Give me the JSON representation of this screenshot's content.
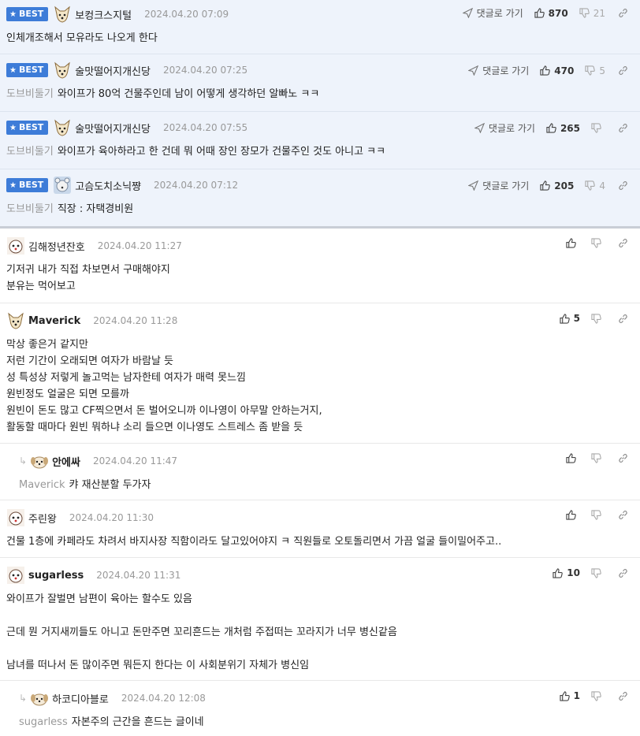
{
  "labels": {
    "best": "BEST",
    "reply_link": "댓글로 가기"
  },
  "best_comments": [
    {
      "nick": "보컹크스지털",
      "date": "2024.04.20 07:09",
      "reply_to": "",
      "text": "인체개조해서 모유라도 나오게 한다",
      "likes": "870",
      "dislikes": "21"
    },
    {
      "nick": "술맛떨어지개신당",
      "date": "2024.04.20 07:25",
      "reply_to": "도브비둘기",
      "text": "와이프가 80억 건물주인데 남이 어떻게 생각하던 알빠노 ㅋㅋ",
      "likes": "470",
      "dislikes": "5"
    },
    {
      "nick": "술맛떨어지개신당",
      "date": "2024.04.20 07:55",
      "reply_to": "도브비둘기",
      "text": "와이프가 육아하라고 한 건데 뭐 어때 장인 장모가 건물주인 것도 아니고 ㅋㅋ",
      "likes": "265",
      "dislikes": ""
    },
    {
      "nick": "고슴도치소닉쨩",
      "date": "2024.04.20 07:12",
      "reply_to": "도브비둘기",
      "text": "직장 : 자택경비원",
      "likes": "205",
      "dislikes": "4"
    }
  ],
  "comments": [
    {
      "nick": "김해정년잔호",
      "date": "2024.04.20 11:27",
      "reply_to": "",
      "text": "기저귀 내가 직접 차보면서 구매해야지\n분유는 먹어보고",
      "likes": ""
    },
    {
      "nick": "Maverick",
      "date": "2024.04.20 11:28",
      "reply_to": "",
      "text": "막상 좋은거 같지만\n저런 기간이 오래되면 여자가 바람날 듯\n성 특성상 저렇게 놀고먹는 남자한테 여자가 매력 못느낌\n원빈정도 얼굴은 되면 모를까\n원빈이 돈도 많고 CF찍으면서 돈 벌어오니까 이나영이 아무말 안하는거지,\n활동할 때마다 원빈 뭐하냐 소리 들으면 이나영도 스트레스 좀 받을 듯",
      "likes": "5"
    },
    {
      "nick": "안에싸",
      "date": "2024.04.20 11:47",
      "reply_to": "Maverick",
      "text": "캬 재산분할 두가자",
      "likes": ""
    },
    {
      "nick": "주린왕",
      "date": "2024.04.20 11:30",
      "reply_to": "",
      "text": "건물 1층에 카페라도 차려서 바지사장 직함이라도 달고있어야지 ㅋ 직원들로 오토돌리면서 가끔 얼굴 들이밀어주고..",
      "likes": ""
    },
    {
      "nick": "sugarless",
      "date": "2024.04.20 11:31",
      "reply_to": "",
      "text": "와이프가 잘벌면 남편이 육아는 할수도 있음\n\n근데 뭔 거지새끼들도 아니고 돈만주면 꼬리흔드는 개처럼 주접떠는 꼬라지가 너무 병신같음\n\n남녀를 떠나서 돈 많이주면 뭐든지 한다는 이 사회분위기 자체가 병신임",
      "likes": "10"
    },
    {
      "nick": "하코디아블로",
      "date": "2024.04.20 12:08",
      "reply_to": "sugarless",
      "text": "자본주의 근간을 흔드는 글이네",
      "likes": "1"
    }
  ]
}
